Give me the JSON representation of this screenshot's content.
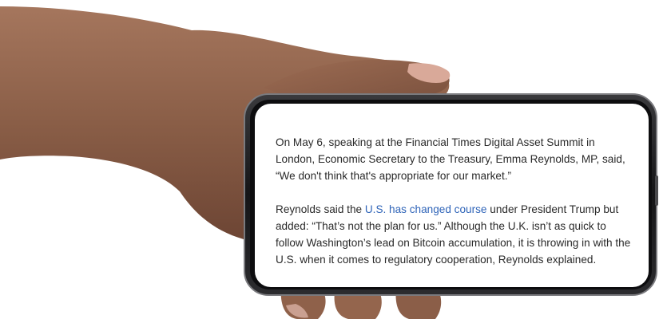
{
  "article": {
    "paragraph1": "On May 6, speaking at the Financial Times Digital Asset Summit in London, Economic Secretary to the Treasury, Emma Reynolds, MP, said, “We don't think that's appropriate for our market.”",
    "paragraph2_before_link": "Reynolds said the ",
    "paragraph2_link": "U.S. has changed course",
    "paragraph2_after_link": " under President Trump but added: “That’s not the plan for us.” Although the U.K. isn’t as quick to follow Washington’s lead on Bitcoin accumulation, it is throwing in with the U.S. when it comes to regulatory cooperation, Reynolds explained."
  },
  "colors": {
    "link": "#2f64b8",
    "text": "#2a2a2a",
    "skin": "#8a5e47",
    "phone_frame": "#1b1b1d"
  }
}
